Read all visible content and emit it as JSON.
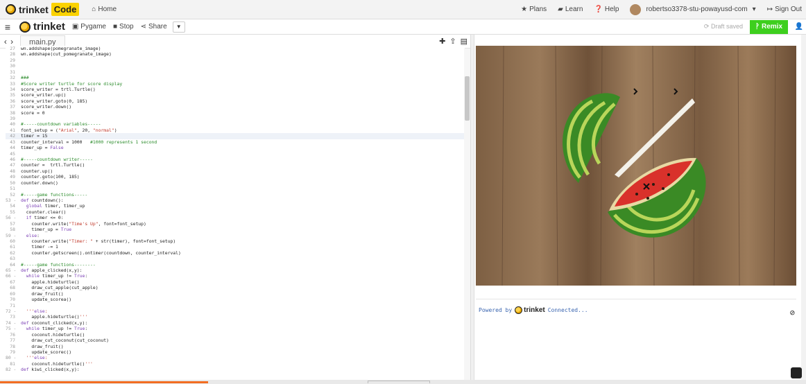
{
  "topnav": {
    "brand": "trinket",
    "badge": "Code",
    "home": "Home",
    "plans": "Plans",
    "learn": "Learn",
    "help": "Help",
    "user": "robertso3378-stu-powayusd-com",
    "signout": "Sign Out"
  },
  "toolbar": {
    "brand": "trinket",
    "pygame": "Pygame",
    "stop": "Stop",
    "share": "Share",
    "draft": "Draft saved",
    "remix": "Remix"
  },
  "tabs": [
    "main.py"
  ],
  "editor": {
    "active_line": 42,
    "lines": [
      {
        "n": "27",
        "t": "wn.addshape(pomegranate_image)"
      },
      {
        "n": "28",
        "t": "wn.addshape(cut_pomegranate_image)"
      },
      {
        "n": "29",
        "t": ""
      },
      {
        "n": "30",
        "t": ""
      },
      {
        "n": "31",
        "t": ""
      },
      {
        "n": "32",
        "t": "###"
      },
      {
        "n": "33",
        "t": "#Score writer turtle for score display"
      },
      {
        "n": "34",
        "t": "score_writer = trtl.Turtle()"
      },
      {
        "n": "35",
        "t": "score_writer.up()"
      },
      {
        "n": "36",
        "t": "score_writer.goto(0, 185)"
      },
      {
        "n": "37",
        "t": "score_writer.down()"
      },
      {
        "n": "38",
        "t": "score = 0"
      },
      {
        "n": "39",
        "t": ""
      },
      {
        "n": "40",
        "t": "#-----countdown variables-----"
      },
      {
        "n": "41",
        "t": "font_setup = (\"Arial\", 20, \"normal\")"
      },
      {
        "n": "42",
        "t": "timer = 15"
      },
      {
        "n": "43",
        "t": "counter_interval = 1000   #1000 represents 1 second"
      },
      {
        "n": "44",
        "t": "timer_up = False"
      },
      {
        "n": "45",
        "t": ""
      },
      {
        "n": "46",
        "t": "#-----countdown writer-----"
      },
      {
        "n": "47",
        "t": "counter =  trtl.Turtle()"
      },
      {
        "n": "48",
        "t": "counter.up()"
      },
      {
        "n": "49",
        "t": "counter.goto(100, 185)"
      },
      {
        "n": "50",
        "t": "counter.down()"
      },
      {
        "n": "51",
        "t": ""
      },
      {
        "n": "52",
        "t": "#-----game functions-----"
      },
      {
        "n": "53 -",
        "t": "def countdown():"
      },
      {
        "n": "54",
        "t": "  global timer, timer_up"
      },
      {
        "n": "55",
        "t": "  counter.clear()"
      },
      {
        "n": "56 -",
        "t": "  if timer <= 0:"
      },
      {
        "n": "57",
        "t": "    counter.write(\"Time's Up\", font=font_setup)"
      },
      {
        "n": "58",
        "t": "    timer_up = True"
      },
      {
        "n": "59 -",
        "t": "  else:"
      },
      {
        "n": "60",
        "t": "    counter.write(\"Timer: \" + str(timer), font=font_setup)"
      },
      {
        "n": "61",
        "t": "    timer -= 1"
      },
      {
        "n": "62",
        "t": "    counter.getscreen().ontimer(countdown, counter_interval)"
      },
      {
        "n": "63",
        "t": ""
      },
      {
        "n": "64",
        "t": "#-----game functions--------"
      },
      {
        "n": "65 -",
        "t": "def apple_clicked(x,y):"
      },
      {
        "n": "66 -",
        "t": "  while timer_up != True:"
      },
      {
        "n": "67",
        "t": "    apple.hideturtle()"
      },
      {
        "n": "68",
        "t": "    draw_cut_apple(cut_apple)"
      },
      {
        "n": "69",
        "t": "    draw_fruit()"
      },
      {
        "n": "70",
        "t": "    update_scorea()"
      },
      {
        "n": "71",
        "t": ""
      },
      {
        "n": "72 -",
        "t": "  '''else:"
      },
      {
        "n": "73",
        "t": "    apple.hideturtle()'''"
      },
      {
        "n": "74 -",
        "t": "def coconut_clicked(x,y):"
      },
      {
        "n": "75 -",
        "t": "  while timer_up != True:"
      },
      {
        "n": "76",
        "t": "    coconut.hideturtle()"
      },
      {
        "n": "77",
        "t": "    draw_cut_coconut(cut_coconut)"
      },
      {
        "n": "78",
        "t": "    draw_fruit()"
      },
      {
        "n": "79",
        "t": "    update_scorec()"
      },
      {
        "n": "80 -",
        "t": "  '''else:"
      },
      {
        "n": "81",
        "t": "    coconut.hideturtle()'''"
      },
      {
        "n": "82 -",
        "t": "def kiwi_clicked(x,y):"
      }
    ]
  },
  "console": {
    "powered": "Powered by",
    "brand": "trinket",
    "status": "Connected..."
  },
  "colors": {
    "accent": "#3ecf1e",
    "badge": "#fbd200",
    "progress": "#f26d21"
  }
}
